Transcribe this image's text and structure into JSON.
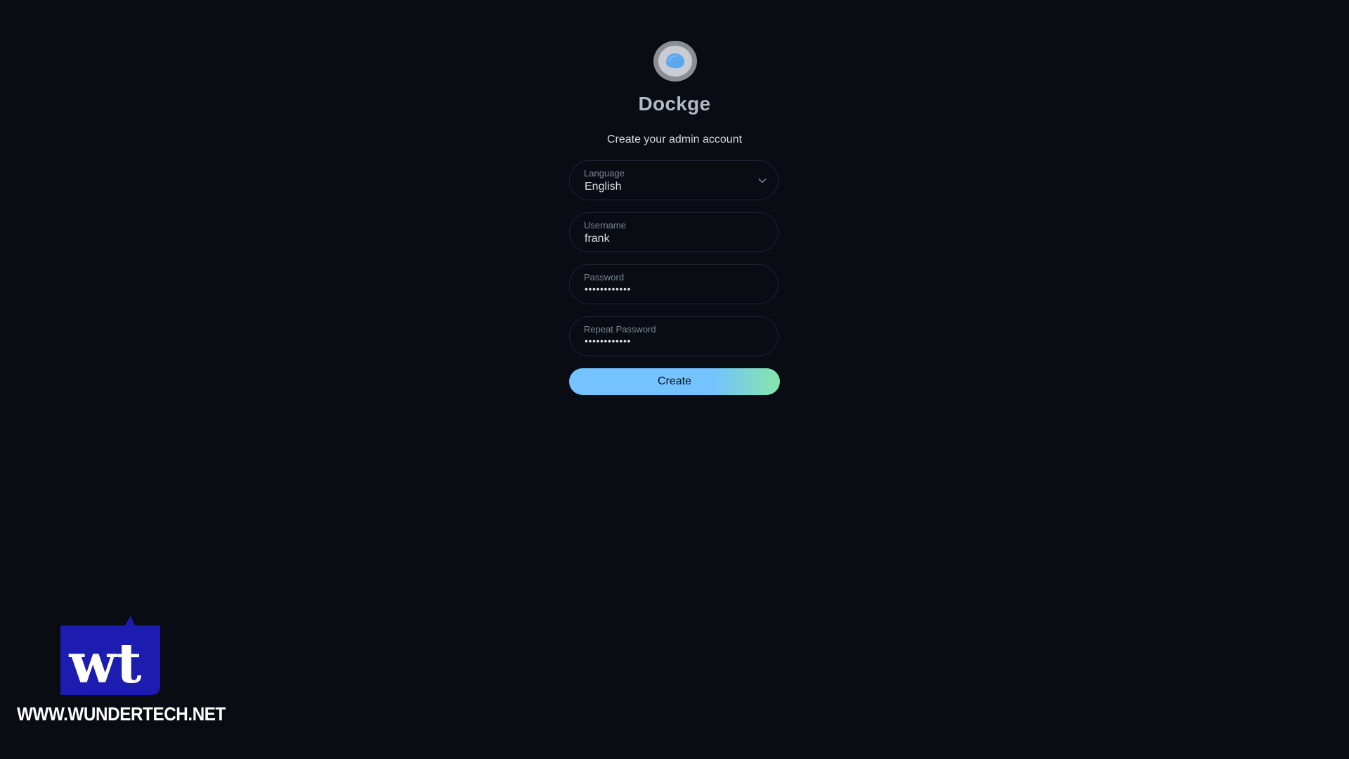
{
  "app": {
    "title": "Dockge",
    "subtitle": "Create your admin account",
    "logo_icon": "dockge-logo-icon"
  },
  "form": {
    "language": {
      "label": "Language",
      "value": "English",
      "icon": "chevron-down-icon"
    },
    "username": {
      "label": "Username",
      "value": "frank"
    },
    "password": {
      "label": "Password",
      "value": "••••••••••••"
    },
    "repeat_password": {
      "label": "Repeat Password",
      "value": "••••••••••••"
    },
    "submit_label": "Create"
  },
  "watermark": {
    "logo_text": "wt",
    "url": "WWW.WUNDERTECH.NET"
  },
  "colors": {
    "background": "#090c12",
    "field_border": "#1d2533",
    "button_start": "#74c2ff",
    "button_end": "#86e6a9",
    "watermark_badge": "#1c1cb0"
  }
}
